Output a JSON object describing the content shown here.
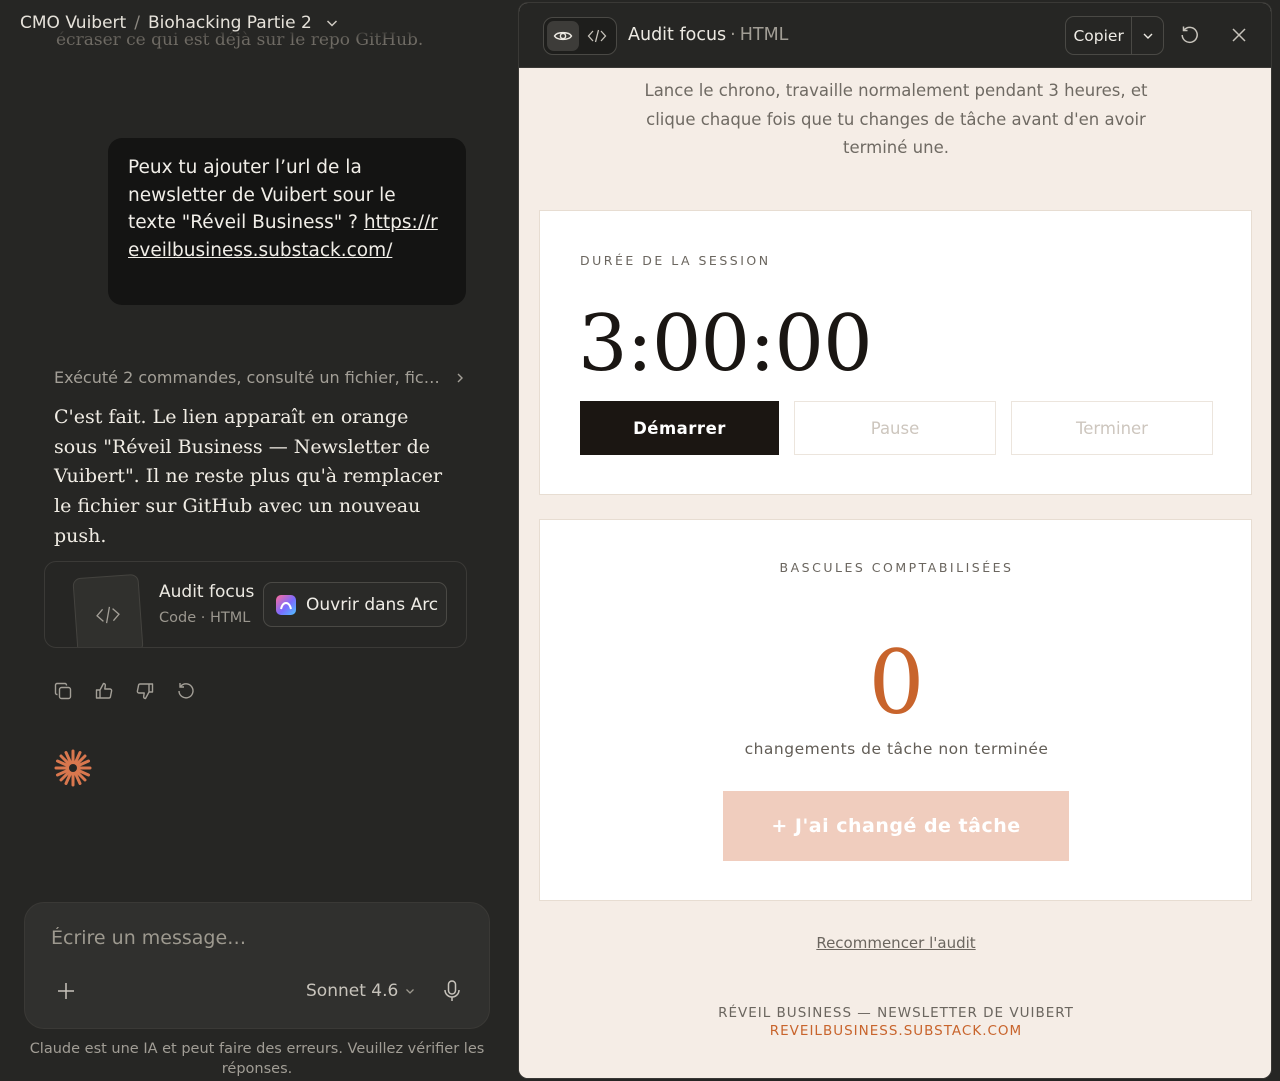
{
  "breadcrumb": {
    "project": "CMO Vuibert",
    "separator": "/",
    "chat": "Biohacking Partie 2"
  },
  "chat": {
    "ghost_line": "écraser ce qui est déjà sur le repo GitHub.",
    "user_message": {
      "text": "Peux tu ajouter l’url de la newsletter de Vuibert sour le texte \"Réveil Business\" ?",
      "link": "https://reveilbusiness.substack.com/"
    },
    "tool_summary": "Exécuté 2 commandes, consulté un fichier, fic…",
    "reply": "C'est fait. Le lien apparaît en orange sous \"Réveil Business — Newsletter de Vuibert\". Il ne reste plus qu'à remplacer le fichier sur GitHub avec un nouveau push.",
    "artifact": {
      "title": "Audit focus",
      "subtitle": "Code · HTML",
      "open_label": "Ouvrir dans Arc"
    },
    "actions": [
      "copy-icon",
      "thumbs-up-icon",
      "thumbs-down-icon",
      "retry-icon"
    ]
  },
  "composer": {
    "placeholder": "Écrire un message…",
    "model": "Sonnet 4.6",
    "disclaimer": "Claude est une IA et peut faire des erreurs. Veuillez vérifier les réponses."
  },
  "artifact_pane": {
    "title": "Audit focus",
    "separator": "·",
    "language": "HTML",
    "copy_label": "Copier",
    "intro": "Lance le chrono, travaille normalement pendant 3 heures, et clique chaque fois que tu changes de tâche avant d'en avoir terminé une.",
    "timer": {
      "label": "DURÉE DE LA SESSION",
      "value": "3:00:00",
      "start": "Démarrer",
      "pause": "Pause",
      "end": "Terminer"
    },
    "counter": {
      "label": "BASCULES COMPTABILISÉES",
      "value": "0",
      "caption": "changements de tâche non terminée",
      "button": "+ J'ai changé de tâche"
    },
    "restart": "Recommencer l'audit",
    "footer": {
      "line1": "RÉVEIL BUSINESS — NEWSLETTER DE VUIBERT",
      "link": "REVEILBUSINESS.SUBSTACK.COM"
    }
  },
  "colors": {
    "chat_bg": "#262624",
    "bubble_bg": "#141413",
    "artifact_bg": "#f5ede6",
    "accent_orange": "#c8642c",
    "start_btn": "#1b1612",
    "switch_btn": "#f0cdbe"
  }
}
